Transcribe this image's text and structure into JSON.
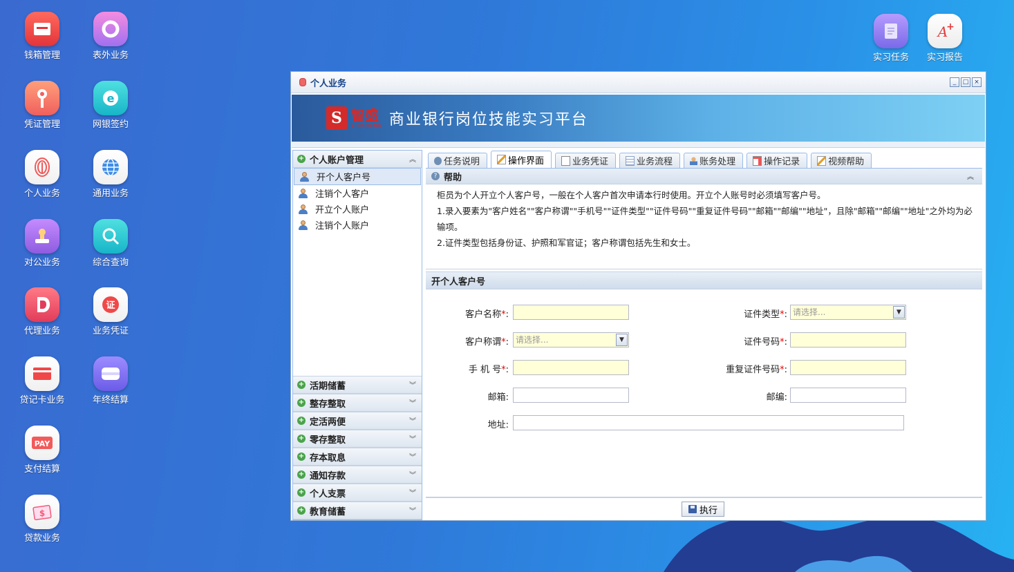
{
  "desktop": {
    "col1": [
      "钱箱管理",
      "凭证管理",
      "个人业务",
      "对公业务",
      "代理业务",
      "贷记卡业务",
      "支付结算",
      "贷款业务"
    ],
    "col2": [
      "表外业务",
      "网银签约",
      "通用业务",
      "综合查询",
      "业务凭证",
      "年终结算"
    ],
    "top_right": [
      "实习任务",
      "实习报告"
    ]
  },
  "window": {
    "title": "个人业务",
    "logo_cn": "智盛",
    "logo_en": "ZHISHENG",
    "logo_mark": "S",
    "platform_title": "商业银行岗位技能实习平台",
    "controls": [
      "_",
      "□",
      "×"
    ]
  },
  "left_menu": {
    "group_title": "个人账户管理",
    "items": [
      "开个人客户号",
      "注销个人客户",
      "开立个人账户",
      "注销个人账户"
    ],
    "selected_index": 0,
    "collapsed_groups": [
      "活期储蓄",
      "整存整取",
      "定活两便",
      "零存整取",
      "存本取息",
      "通知存款",
      "个人支票",
      "教育储蓄"
    ]
  },
  "tabs": [
    "任务说明",
    "操作界面",
    "业务凭证",
    "业务流程",
    "账务处理",
    "操作记录",
    "视频帮助"
  ],
  "active_tab": "操作界面",
  "help": {
    "title": "帮助",
    "lines": [
      "柜员为个人开立个人客户号，一般在个人客户首次申请本行时使用。开立个人账号时必须填写客户号。",
      "1.录入要素为\"客户姓名\"\"客户称谓\"\"手机号\"\"证件类型\"\"证件号码\"\"重复证件号码\"\"邮箱\"\"邮编\"\"地址\"，且除\"邮箱\"\"邮编\"\"地址\"之外均为必输项。",
      "2.证件类型包括身份证、护照和军官证；客户称谓包括先生和女士。"
    ]
  },
  "form": {
    "title": "开个人客户号",
    "required_mark": "*",
    "fields": {
      "customer_name": {
        "label": "客户名称",
        "value": ""
      },
      "id_type": {
        "label": "证件类型",
        "placeholder": "请选择..."
      },
      "title": {
        "label": "客户称谓",
        "placeholder": "请选择..."
      },
      "id_number": {
        "label": "证件号码",
        "value": ""
      },
      "phone": {
        "label": "手 机 号",
        "value": ""
      },
      "id_number_repeat": {
        "label": "重复证件号码",
        "value": ""
      },
      "email": {
        "label": "邮箱",
        "value": ""
      },
      "postcode": {
        "label": "邮编",
        "value": ""
      },
      "address": {
        "label": "地址",
        "value": ""
      }
    },
    "colon": ":"
  },
  "execute_label": "执行",
  "colors": {
    "required": "#ee0000",
    "input_required_bg": "#ffffd8",
    "banner_logo": "#d42a2a"
  }
}
